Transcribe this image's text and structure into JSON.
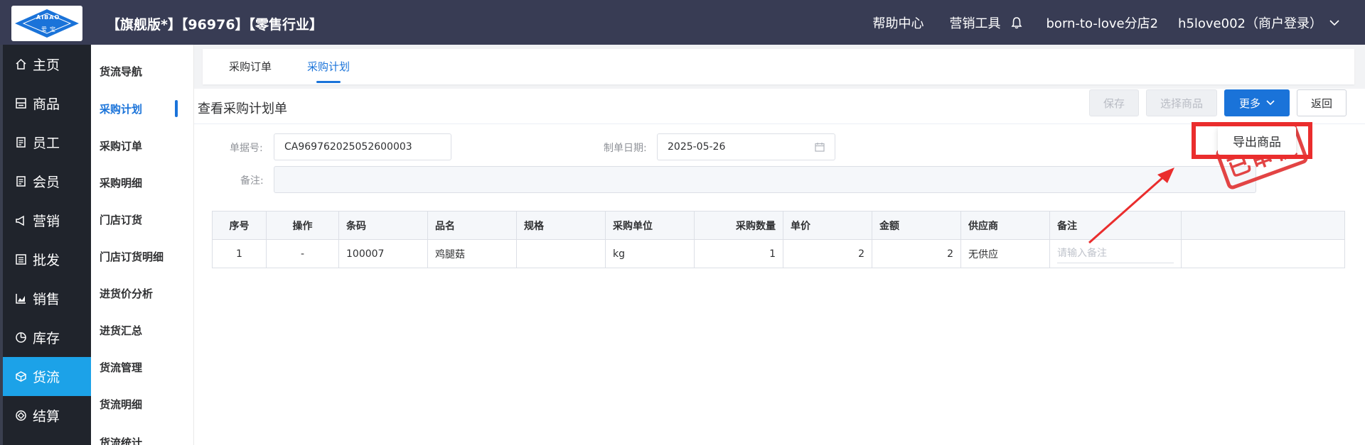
{
  "header": {
    "logo_text_top": "AIBAO",
    "logo_text_bottom": "爱宝",
    "edition": "【旗舰版*】【96976】【零售行业】",
    "help": "帮助中心",
    "marketing_tools": "营销工具",
    "store": "born-to-love分店2",
    "user": "h5love002（商户登录）"
  },
  "sidebar": {
    "items": [
      {
        "label": "主页",
        "icon": "home-icon"
      },
      {
        "label": "商品",
        "icon": "goods-icon"
      },
      {
        "label": "员工",
        "icon": "staff-icon"
      },
      {
        "label": "会员",
        "icon": "member-icon"
      },
      {
        "label": "营销",
        "icon": "megaphone-icon"
      },
      {
        "label": "批发",
        "icon": "wholesale-icon"
      },
      {
        "label": "销售",
        "icon": "chart-icon"
      },
      {
        "label": "库存",
        "icon": "pie-icon"
      },
      {
        "label": "货流",
        "icon": "cube-icon"
      },
      {
        "label": "结算",
        "icon": "settle-icon"
      }
    ],
    "active": "货流"
  },
  "subnav": {
    "items": [
      "货流导航",
      "采购计划",
      "采购订单",
      "采购明细",
      "门店订货",
      "门店订货明细",
      "进货价分析",
      "进货汇总",
      "货流管理",
      "货流明细",
      "货流统计"
    ],
    "active": "采购计划"
  },
  "tabs": [
    "采购订单",
    "采购计划"
  ],
  "page": {
    "title": "查看采购计划单",
    "buttons": {
      "save": "保存",
      "choose": "选择商品",
      "more": "更多",
      "back": "返回"
    },
    "dropdown_item": "导出商品",
    "stamp": "已审核"
  },
  "form": {
    "order_no_label": "单据号:",
    "order_no": "CA969762025052600003",
    "date_label": "制单日期:",
    "date": "2025-05-26",
    "remark_label": "备注:",
    "remark": ""
  },
  "table": {
    "headers": [
      "序号",
      "操作",
      "条码",
      "品名",
      "规格",
      "采购单位",
      "采购数量",
      "单价",
      "金额",
      "供应商",
      "备注",
      ""
    ],
    "rows": [
      {
        "index": "1",
        "op": "-",
        "barcode": "100007",
        "name": "鸡腿菇",
        "spec": "",
        "unit": "kg",
        "qty": "1",
        "price": "2",
        "amount": "2",
        "supplier": "无供应",
        "remark_placeholder": "请输入备注"
      }
    ]
  },
  "colors": {
    "header_bg": "#383c54",
    "nav_bg": "#20242c",
    "nav_active": "#1ca2e8",
    "primary": "#1a73d9",
    "annotation": "#ea2d2d"
  }
}
